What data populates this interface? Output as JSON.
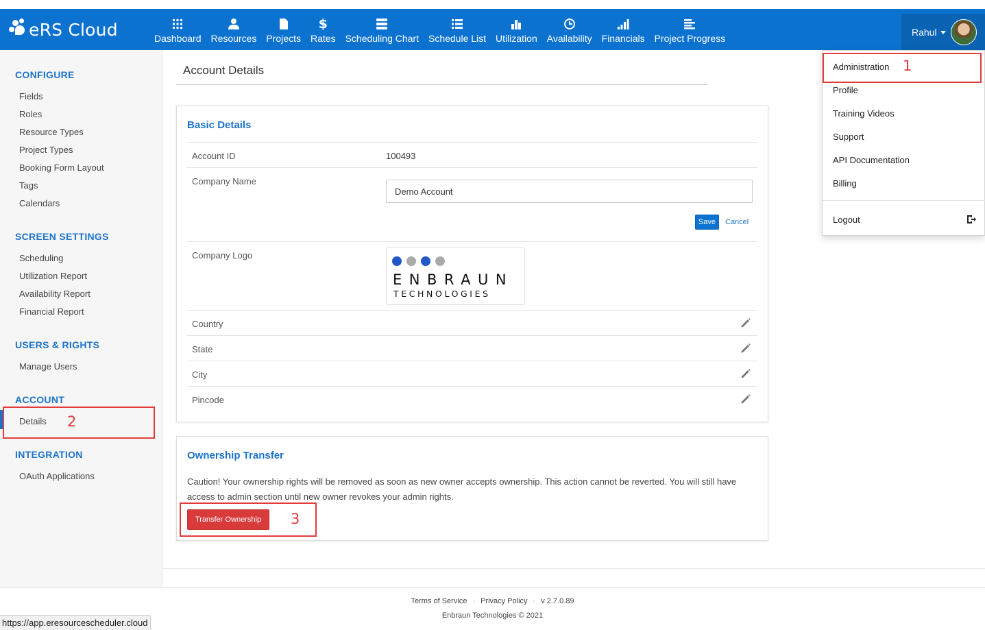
{
  "app": {
    "brand": "eRS Cloud"
  },
  "nav": [
    {
      "label": "Dashboard",
      "icon": "dashboard-icon"
    },
    {
      "label": "Resources",
      "icon": "user-icon"
    },
    {
      "label": "Projects",
      "icon": "file-icon"
    },
    {
      "label": "Rates",
      "icon": "dollar-icon"
    },
    {
      "label": "Scheduling Chart",
      "icon": "server-icon"
    },
    {
      "label": "Schedule List",
      "icon": "list-icon"
    },
    {
      "label": "Utilization",
      "icon": "bar-chart-icon"
    },
    {
      "label": "Availability",
      "icon": "clock-icon"
    },
    {
      "label": "Financials",
      "icon": "signal-icon"
    },
    {
      "label": "Project Progress",
      "icon": "align-left-icon"
    }
  ],
  "user": {
    "name": "Rahul"
  },
  "sidebar": {
    "configure": {
      "heading": "CONFIGURE",
      "items": [
        "Fields",
        "Roles",
        "Resource Types",
        "Project Types",
        "Booking Form Layout",
        "Tags",
        "Calendars"
      ]
    },
    "screen_settings": {
      "heading": "SCREEN SETTINGS",
      "items": [
        "Scheduling",
        "Utilization Report",
        "Availability Report",
        "Financial Report"
      ]
    },
    "users_rights": {
      "heading": "USERS & RIGHTS",
      "items": [
        "Manage Users"
      ]
    },
    "account": {
      "heading": "ACCOUNT",
      "items": [
        "Details"
      ]
    },
    "integration": {
      "heading": "INTEGRATION",
      "items": [
        "OAuth Applications"
      ]
    }
  },
  "main": {
    "title": "Account Details",
    "basic": {
      "title": "Basic Details",
      "account_id_label": "Account ID",
      "account_id_value": "100493",
      "company_name_label": "Company Name",
      "company_name_value": "Demo Account",
      "save_label": "Save",
      "cancel_label": "Cancel",
      "company_logo_label": "Company Logo",
      "logo_word": "ENBRAUN",
      "logo_sub": "TECHNOLOGIES",
      "country_label": "Country",
      "state_label": "State",
      "city_label": "City",
      "pincode_label": "Pincode"
    },
    "ownership": {
      "title": "Ownership Transfer",
      "caution": "Caution! Your ownership rights will be removed as soon as new owner accepts ownership. This action cannot be reverted. You will still have access to admin section until new owner revokes your admin rights.",
      "transfer_label": "Transfer Ownership"
    }
  },
  "dropdown": {
    "items": [
      "Administration",
      "Profile",
      "Training Videos",
      "Support",
      "API Documentation",
      "Billing"
    ],
    "logout": "Logout"
  },
  "annotations": [
    "1",
    "2",
    "3"
  ],
  "footer": {
    "terms": "Terms of Service",
    "privacy": "Privacy Policy",
    "version": "v 2.7.0.89",
    "copyright": "Enbraun Technologies © 2021"
  },
  "status_url": "https://app.eresourcescheduler.cloud",
  "colors": {
    "primary": "#0b72d0",
    "danger": "#d93b3b",
    "annotation": "#e23b3b",
    "logo_blue": "#2257c9",
    "logo_gray": "#aaaaaa"
  }
}
